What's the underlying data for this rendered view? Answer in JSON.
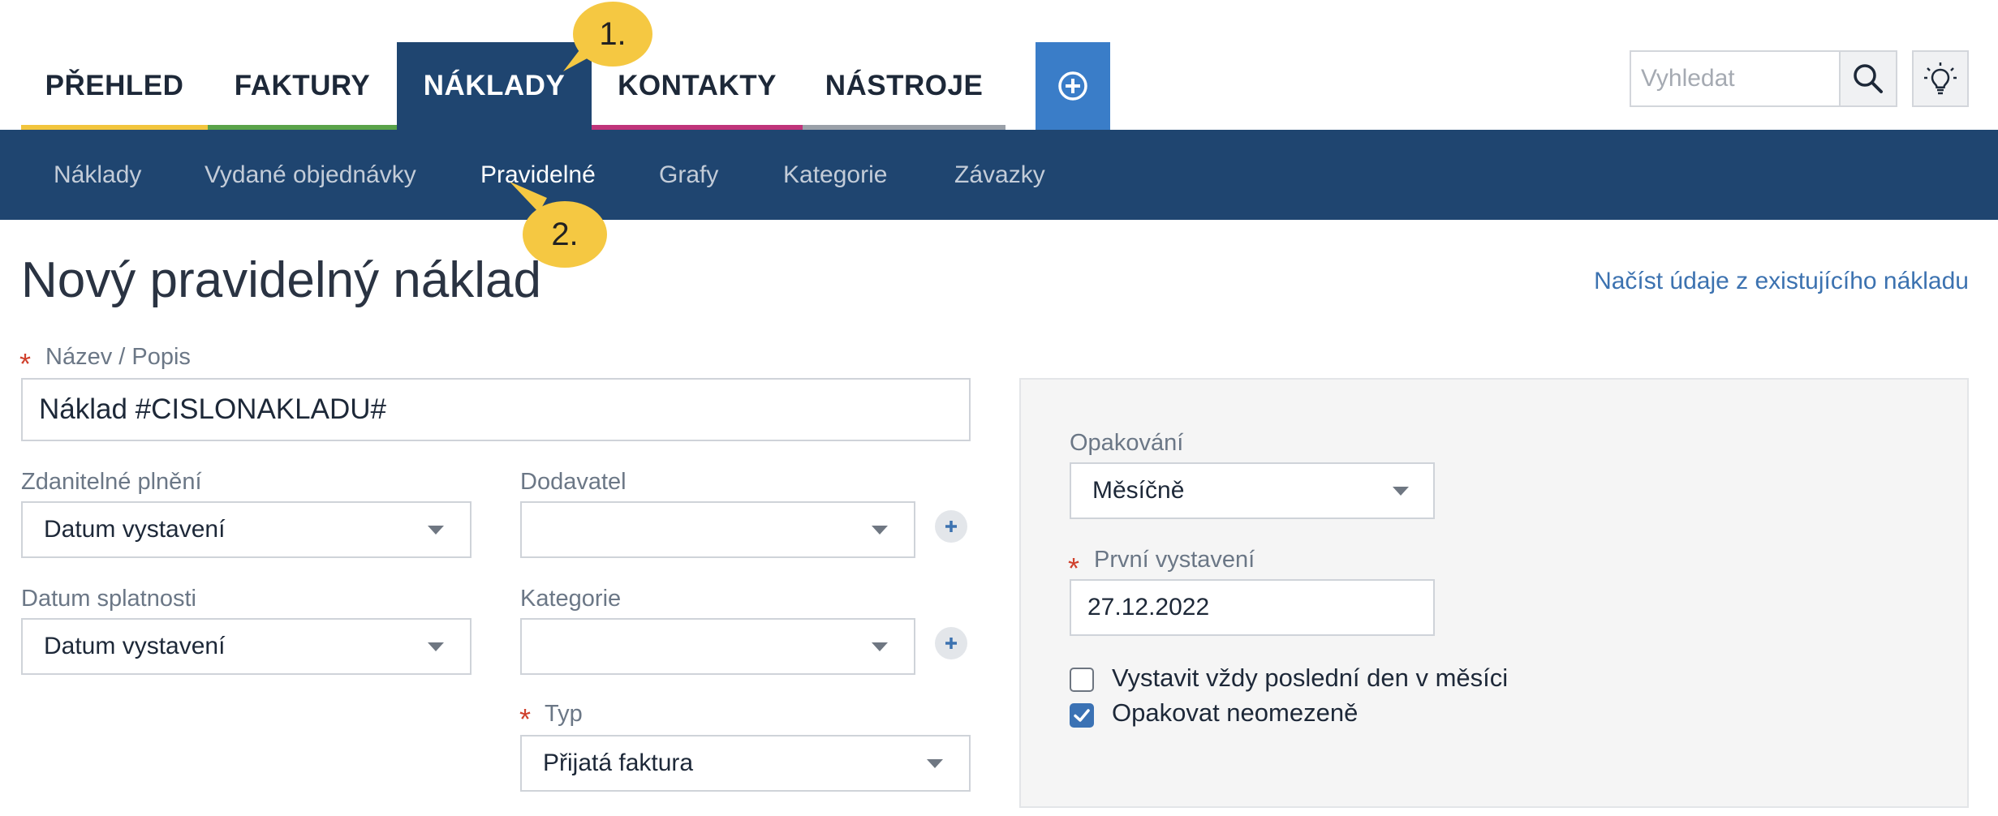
{
  "tabs": [
    {
      "label": "PŘEHLED",
      "underline": "#f2c53d"
    },
    {
      "label": "FAKTURY",
      "underline": "#5aa34a"
    },
    {
      "label": "NÁKLADY",
      "underline": "#1f4570",
      "active": true
    },
    {
      "label": "KONTAKTY",
      "underline": "#c0347a"
    },
    {
      "label": "NÁSTROJE",
      "underline": "#9aa0a8"
    }
  ],
  "search": {
    "placeholder": "Vyhledat"
  },
  "subnav": [
    {
      "label": "Náklady"
    },
    {
      "label": "Vydané objednávky"
    },
    {
      "label": "Pravidelné",
      "active": true
    },
    {
      "label": "Grafy"
    },
    {
      "label": "Kategorie"
    },
    {
      "label": "Závazky"
    }
  ],
  "callouts": [
    "1.",
    "2."
  ],
  "page": {
    "title": "Nový pravidelný náklad",
    "load_link": "Načíst údaje z existujícího nákladu"
  },
  "form": {
    "required_mark": "*",
    "name_label": "Název / Popis",
    "name_value": "Náklad #CISLONAKLADU#",
    "taxable_label": "Zdanitelné plnění",
    "taxable_value": "Datum vystavení",
    "supplier_label": "Dodavatel",
    "supplier_value": "",
    "due_label": "Datum splatnosti",
    "due_value": "Datum vystavení",
    "category_label": "Kategorie",
    "category_value": "",
    "type_label": "Typ",
    "type_value": "Přijatá faktura"
  },
  "panel": {
    "repeat_label": "Opakování",
    "repeat_value": "Měsíčně",
    "first_label": "První vystavení",
    "first_value": "27.12.2022",
    "last_day_label": "Vystavit vždy poslední den v měsíci",
    "last_day_checked": false,
    "unlimited_label": "Opakovat neomezeně",
    "unlimited_checked": true
  },
  "colors": {
    "nav_dark": "#1f4570",
    "accent_blue": "#3a7dc8",
    "callout": "#f5c842",
    "required": "#d0402c",
    "link": "#3c72b0"
  }
}
